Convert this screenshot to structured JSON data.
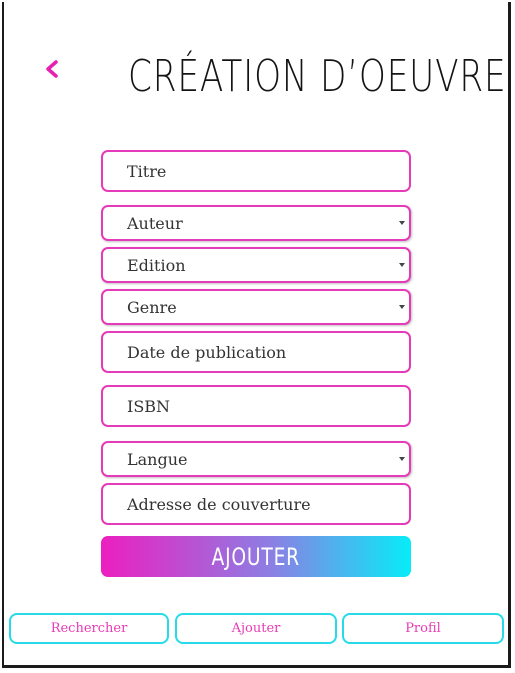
{
  "header": {
    "title": "CRÉATION D’OEUVRE",
    "back_icon": "chevron-left-icon"
  },
  "form": {
    "titre": "Titre",
    "auteur": "Auteur",
    "edition": "Edition",
    "genre": "Genre",
    "date_publication": "Date de publication",
    "isbn": "ISBN",
    "langue": "Langue",
    "adresse_couverture": "Adresse de couverture"
  },
  "submit": {
    "label": "AJOUTER"
  },
  "bottom_nav": {
    "rechercher": "Rechercher",
    "ajouter": "Ajouter",
    "profil": "Profil"
  },
  "colors": {
    "accent": "#e33bb9",
    "nav_border": "#26dbe7",
    "gradient_start": "#ec1fbf",
    "gradient_end": "#07ecf7"
  }
}
